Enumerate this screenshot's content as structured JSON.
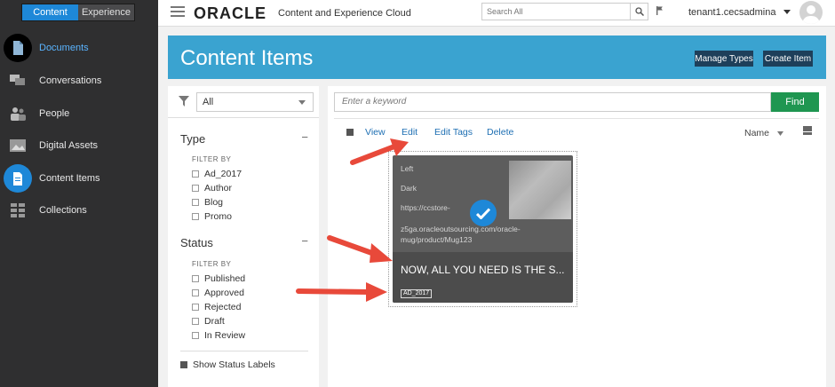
{
  "sidebar": {
    "mode_tabs": [
      "Content",
      "Experience"
    ],
    "items": [
      {
        "label": "Documents",
        "icon": "document-icon"
      },
      {
        "label": "Conversations",
        "icon": "chat-icon"
      },
      {
        "label": "People",
        "icon": "people-icon"
      },
      {
        "label": "Digital Assets",
        "icon": "image-icon"
      },
      {
        "label": "Content Items",
        "icon": "content-item-icon"
      },
      {
        "label": "Collections",
        "icon": "grid-icon"
      }
    ]
  },
  "header": {
    "brand": "ORACLE",
    "brand_sub": "Content and Experience Cloud",
    "search_placeholder": "Search All",
    "user": "tenant1.cecsadmina"
  },
  "banner": {
    "title": "Content Items",
    "manage_types": "Manage Types",
    "create_item": "Create Item"
  },
  "filter": {
    "select_value": "All",
    "type_title": "Type",
    "filter_by": "FILTER BY",
    "types": [
      "Ad_2017",
      "Author",
      "Blog",
      "Promo"
    ],
    "status_title": "Status",
    "statuses": [
      "Published",
      "Approved",
      "Rejected",
      "Draft",
      "In Review"
    ],
    "show_status_labels": "Show Status Labels",
    "collapse_symbol": "−"
  },
  "main": {
    "keyword_placeholder": "Enter a keyword",
    "find": "Find",
    "actions": [
      "View",
      "Edit",
      "Edit Tags",
      "Delete"
    ],
    "sort_label": "Name"
  },
  "card": {
    "lines": [
      "Left",
      "Dark",
      "https://ccstore-",
      "z5ga.oracleoutsourcing.com/oracle-",
      "mug/product/Mug123"
    ],
    "title": "NOW, ALL YOU NEED IS THE S...",
    "tag": "AD_2017"
  },
  "colors": {
    "accent": "#1e88d8",
    "banner": "#3aa3d0",
    "find": "#1f9651",
    "arrow": "#e8493a"
  }
}
